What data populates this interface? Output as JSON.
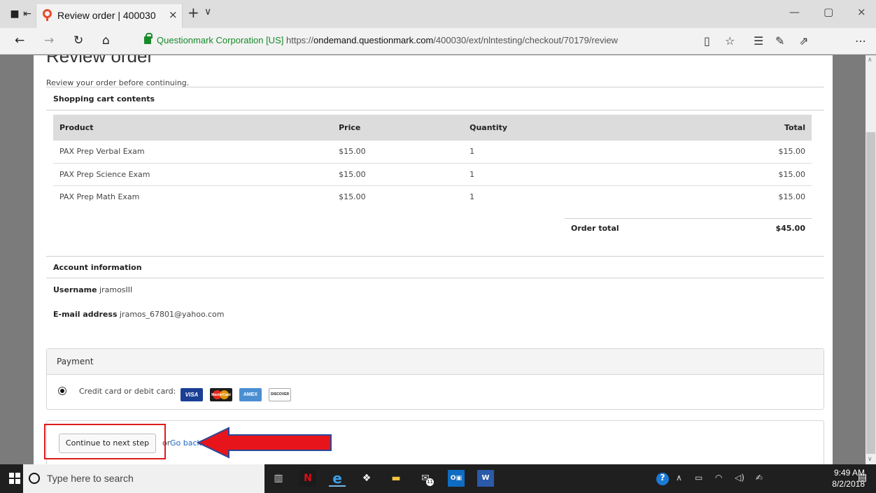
{
  "browser": {
    "tab_title": "Review order | 400030",
    "tab_close": "×",
    "new_tab": "+",
    "tab_dropdown": "∨",
    "win_min": "—",
    "win_max": "▢",
    "win_close": "×",
    "back": "←",
    "forward": "→",
    "refresh": "↻",
    "home": "⌂",
    "address": {
      "org": "Questionmark Corporation [US]",
      "protocol": "https://",
      "host": "ondemand.questionmark.com",
      "path": "/400030/ext/nlntesting/checkout/70179/review"
    },
    "toolbar_icons": [
      "reading-view-icon",
      "favorite-star-icon",
      "favorites-hub-icon",
      "pen-icon",
      "share-icon",
      "more-icon"
    ]
  },
  "page": {
    "heading": "Review order",
    "intro": "Review your order before continuing.",
    "cart_section_title": "Shopping cart contents",
    "cart": {
      "columns": [
        "Product",
        "Price",
        "Quantity",
        "Total"
      ],
      "rows": [
        {
          "product": "PAX Prep Verbal Exam",
          "price": "$15.00",
          "quantity": "1",
          "total": "$15.00"
        },
        {
          "product": "PAX Prep Science Exam",
          "price": "$15.00",
          "quantity": "1",
          "total": "$15.00"
        },
        {
          "product": "PAX Prep Math Exam",
          "price": "$15.00",
          "quantity": "1",
          "total": "$15.00"
        }
      ],
      "order_total_label": "Order total",
      "order_total_value": "$45.00"
    },
    "account": {
      "title": "Account information",
      "username_label": "Username",
      "username": "jramosIII",
      "email_label": "E-mail address",
      "email": "jramos_67801@yahoo.com"
    },
    "payment": {
      "title": "Payment",
      "option_label": "Credit card or debit card:",
      "cards": [
        "VISA",
        "MasterCard",
        "AMEX",
        "DISCOVER"
      ]
    },
    "actions": {
      "continue_label": "Continue to next step",
      "or_text": "or",
      "go_back_label": "Go back"
    }
  },
  "taskbar": {
    "search_placeholder": "Type here to search",
    "mail_badge": "11",
    "time": "9:49 AM",
    "date": "8/2/2018"
  },
  "colors": {
    "address_org": "#168a2a",
    "link": "#1a66c4",
    "highlight": "#e01b1b",
    "arrow": "#e8141b"
  }
}
